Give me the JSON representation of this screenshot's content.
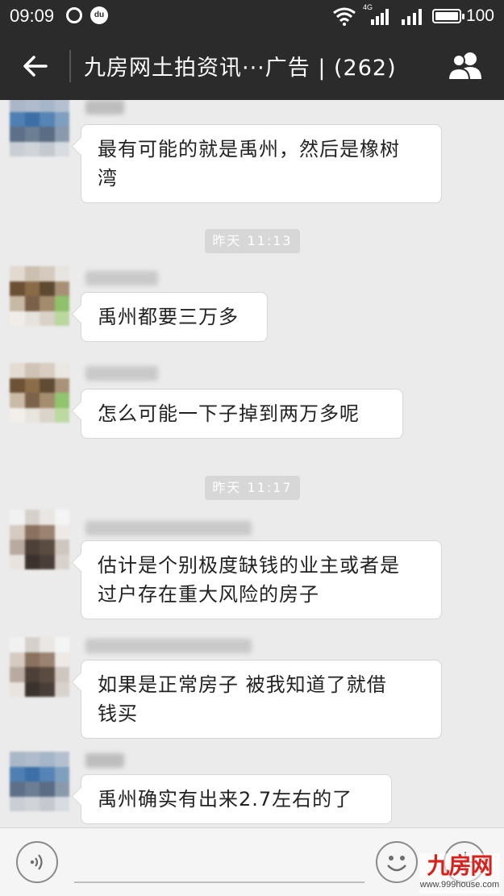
{
  "status_bar": {
    "time": "09:09",
    "network_tag": "4G",
    "battery_level_percent": 100,
    "battery_text": "100",
    "icons": [
      "netease-music-icon",
      "baidu-du-icon",
      "wifi-icon",
      "signal-icon",
      "signal-icon",
      "battery-icon"
    ]
  },
  "header": {
    "title": "九房网土拍资讯···广告 | (262)",
    "back_icon": "back-arrow-icon",
    "group_icon": "group-members-icon"
  },
  "messages": [
    {
      "text": "最有可能的就是禹州，然后是橡树湾",
      "line1": "最有可能的就是禹州，然后是橡树",
      "line2": "湾"
    },
    {
      "text": "禹州都要三万多"
    },
    {
      "text": "怎么可能一下子掉到两万多呢"
    },
    {
      "text": "估计是个别极度缺钱的业主或者是过户存在重大风险的房子",
      "line1": "估计是个别极度缺钱的业主或者是",
      "line2": "过户存在重大风险的房子"
    },
    {
      "text": "如果是正常房子 被我知道了就借钱买",
      "line1": "如果是正常房子 被我知道了就借",
      "line2": "钱买"
    },
    {
      "text": "禹州确实有出来2.7左右的了"
    }
  ],
  "timestamps": [
    "昨天 11:13",
    "昨天 11:17"
  ],
  "input_bar": {
    "voice_icon": "voice-icon",
    "emoji_icon": "emoji-icon",
    "more_icon": "plus-icon",
    "input_value": ""
  },
  "watermark": {
    "logo_text": "九房网",
    "url": "www.999house.com",
    "brand_color": "#d9211b"
  },
  "colors": {
    "header_bg": "#2b2b2b",
    "chat_bg": "#ebebeb",
    "bubble_bg": "#ffffff",
    "timestamp_bg": "#d7d7d7"
  }
}
